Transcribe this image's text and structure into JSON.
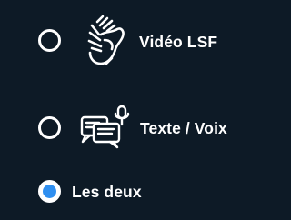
{
  "options": [
    {
      "label": "Vidéo LSF",
      "icon": "sign-language-hands-icon",
      "selected": false
    },
    {
      "label": "Texte / Voix",
      "icon": "chat-bubbles-microphone-icon",
      "selected": false
    },
    {
      "label": "Les deux",
      "icon": "",
      "selected": true
    }
  ],
  "colors": {
    "background": "#0d1a26",
    "foreground": "#ffffff",
    "accent": "#2f8ff0"
  }
}
